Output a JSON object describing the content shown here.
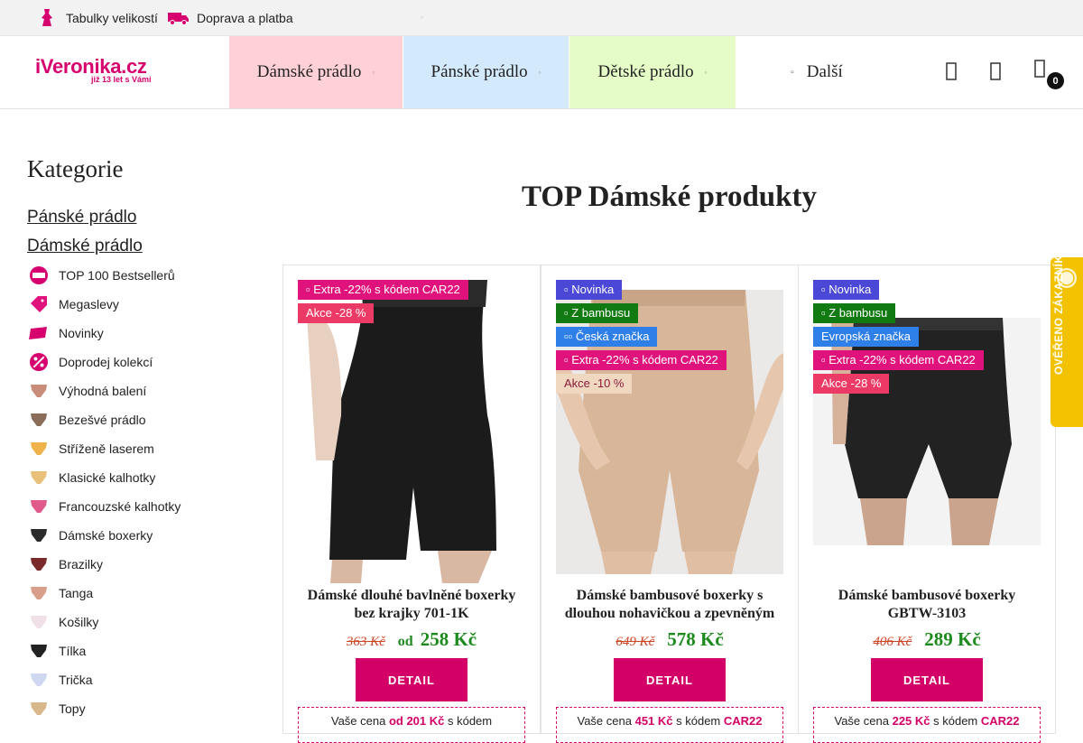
{
  "topbar": {
    "size_tables": "Tabulky velikostí",
    "shipping": "Doprava a platba",
    "dot": "▫"
  },
  "logo": {
    "brand": "iVeronika.cz",
    "tagline": "již 13 let s Vámi"
  },
  "nav": {
    "women": "Dámské prádlo",
    "men": "Pánské prádlo",
    "kids": "Dětské prádlo",
    "more": "Další",
    "caret": "▫",
    "more_icon": "▫"
  },
  "cart": {
    "count": "0"
  },
  "sidebar": {
    "title": "Kategorie",
    "main": [
      "Pánské prádlo",
      "Dámské prádlo"
    ],
    "items": [
      "TOP 100 Bestsellerů",
      "Megaslevy",
      "Novinky",
      "Doprodej kolekcí",
      "Výhodná balení",
      "Bezešvé prádlo",
      "Stříženě laserem",
      "Klasické kalhotky",
      "Francouzské kalhotky",
      "Dámské boxerky",
      "Brazilky",
      "Tanga",
      "Košilky",
      "Tílka",
      "Trička",
      "Topy"
    ]
  },
  "main": {
    "title": "TOP Dámské produkty"
  },
  "products": [
    {
      "badges": [
        "▫ Extra -22% s kódem CAR22",
        "Akce -28 %"
      ],
      "name": "Dámské dlouhé bavlněné boxerky bez krajky 701-1K",
      "old_price": "363 Kč",
      "from": "od",
      "price": "258 Kč",
      "detail": "DETAIL",
      "promo_pre": "Vaše cena ",
      "promo_price": "od 201 Kč",
      "promo_post": " s kódem"
    },
    {
      "badges": [
        "▫ Novinka",
        "▫ Z bambusu",
        "▫▫ Česká značka",
        "▫ Extra -22% s kódem CAR22",
        "Akce -10 %"
      ],
      "name": "Dámské bambusové boxerky s dlouhou nohavičkou a zpevněným",
      "old_price": "649 Kč",
      "price": "578 Kč",
      "detail": "DETAIL",
      "promo_pre": "Vaše cena ",
      "promo_price": "451 Kč",
      "promo_post": " s kódem ",
      "promo_code": "CAR22"
    },
    {
      "badges": [
        "▫ Novinka",
        "▫ Z bambusu",
        "Evropská značka",
        "▫ Extra -22% s kódem CAR22",
        "Akce -28 %"
      ],
      "name": "Dámské bambusové boxerky GBTW-3103",
      "old_price": "406 Kč",
      "price": "289 Kč",
      "detail": "DETAIL",
      "promo_pre": "Vaše cena ",
      "promo_price": "225 Kč",
      "promo_post": " s kódem ",
      "promo_code": "CAR22"
    }
  ],
  "verified": {
    "label": "OVĚŘENO ZÁKAZNÍKY"
  },
  "colors": {
    "brand": "#d6006e",
    "nav_women": "#ffd1d6",
    "nav_men": "#d3eafc",
    "nav_kids": "#e5fcc6",
    "badge_extra": "#e0137d",
    "badge_sale": "#ec3a66",
    "badge_new": "#4b48d8",
    "badge_bamboo": "#127a12",
    "badge_brand": "#2f7fe8",
    "price_green": "#1d8a1d"
  }
}
